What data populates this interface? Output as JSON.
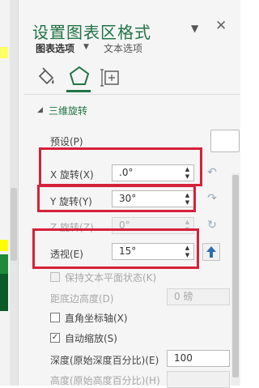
{
  "panel": {
    "title": "设置图表区格式",
    "tabs": [
      {
        "label": "图表选项"
      },
      {
        "label": "文本选项"
      }
    ],
    "icon_tabs": [
      "paint-bucket-icon",
      "pentagon-effects-icon",
      "size-properties-icon"
    ],
    "active_icon_tab": "pentagon-effects-icon"
  },
  "section": {
    "title": "三维旋转",
    "preset_label": "预设(P)",
    "x_rotation": {
      "label": "X 旋转(X)",
      "value": ".0°"
    },
    "y_rotation": {
      "label": "Y 旋转(Y)",
      "value": "30°"
    },
    "z_rotation": {
      "label": "Z 旋转(Z)",
      "value": "0°"
    },
    "perspective": {
      "label": "透视(E)",
      "value": "15°"
    },
    "keep_text_flat": {
      "label": "保持文本平面状态(K)",
      "checked": false
    },
    "distance_from_ground": {
      "label": "距底边高度(D)",
      "value": "0 磅"
    },
    "right_angle_axes": {
      "label": "直角坐标轴(X)",
      "checked": false
    },
    "autoscale": {
      "label": "自动缩放(S)",
      "checked": true
    },
    "depth": {
      "label": "深度(原始深度百分比)(E)",
      "value": "100"
    },
    "height": {
      "label": "高度(原始高度百分比)(H)"
    }
  },
  "colors": {
    "accent": "#217346",
    "highlight_box": "#d6213a"
  }
}
